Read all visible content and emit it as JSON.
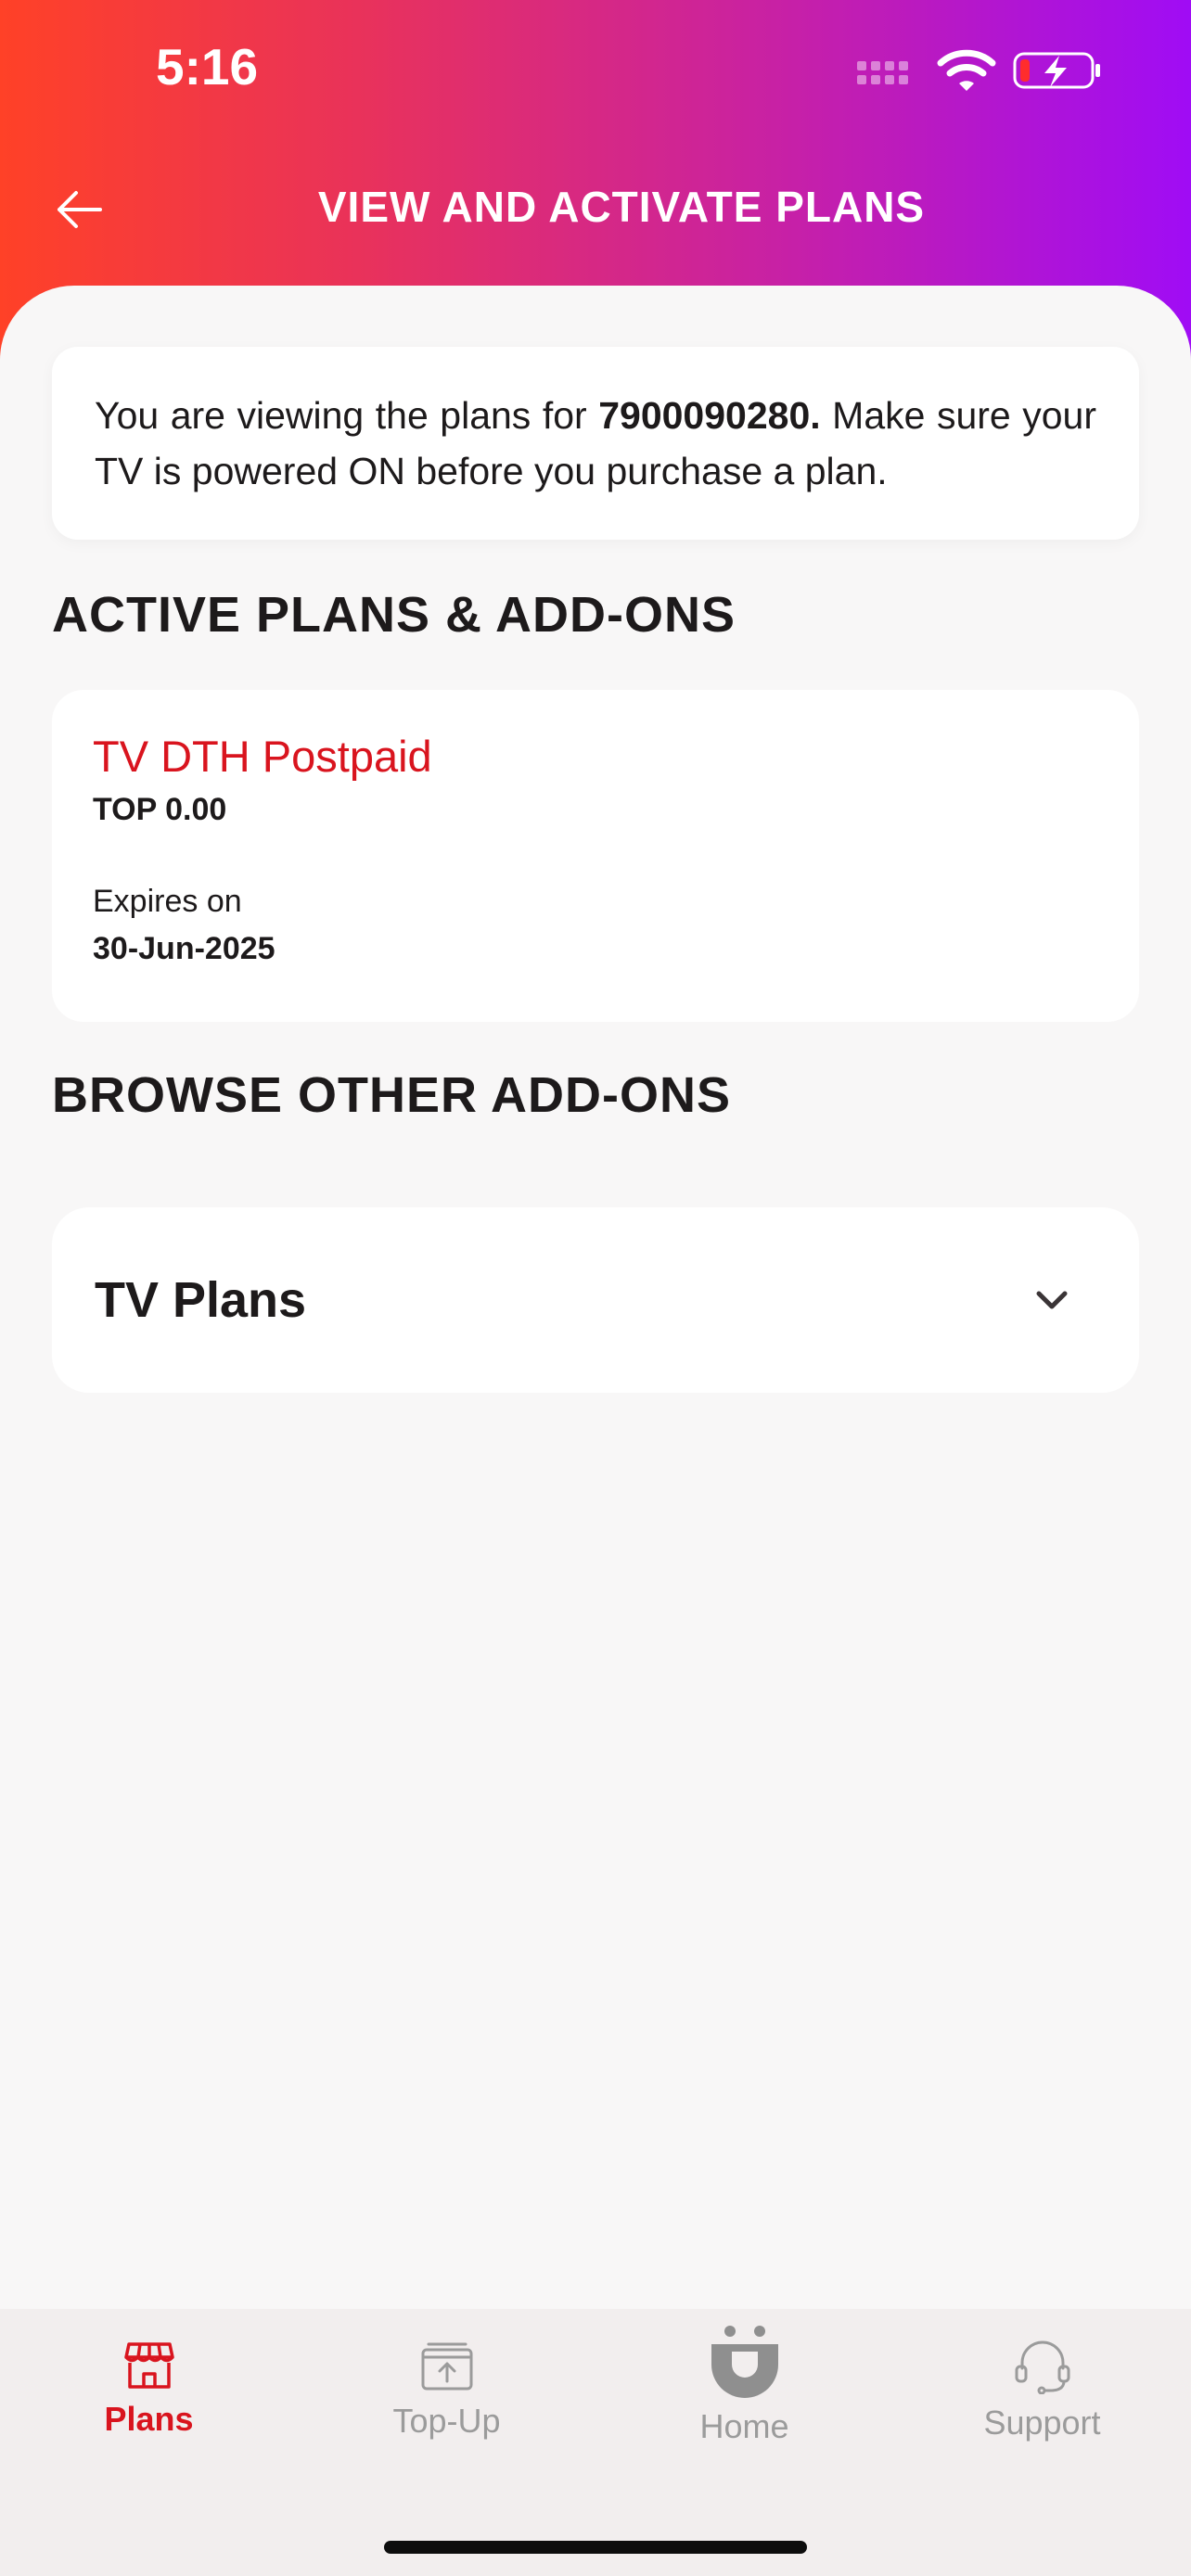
{
  "status_bar": {
    "time": "5:16"
  },
  "header": {
    "title": "VIEW AND ACTIVATE PLANS"
  },
  "info": {
    "text_before": "You are viewing the plans for ",
    "number": "7900090280.",
    "text_after": " Make sure your TV is powered ON before you purchase a plan."
  },
  "active_section": {
    "title": "ACTIVE PLANS & ADD-ONS",
    "plan": {
      "name": "TV DTH Postpaid",
      "price": "TOP 0.00",
      "expires_label": "Expires on",
      "expires_date": "30-Jun-2025"
    }
  },
  "browse_section": {
    "title": "BROWSE OTHER ADD-ONS",
    "accordion_label": "TV Plans"
  },
  "tabs": [
    {
      "label": "Plans",
      "icon": "store-icon"
    },
    {
      "label": "Top-Up",
      "icon": "top-up-icon"
    },
    {
      "label": "Home",
      "icon": "home-smiley-icon"
    },
    {
      "label": "Support",
      "icon": "headset-icon"
    }
  ],
  "colors": {
    "accent": "#d9141e",
    "gradient_start": "#ff4127",
    "gradient_end": "#a00cf5"
  }
}
